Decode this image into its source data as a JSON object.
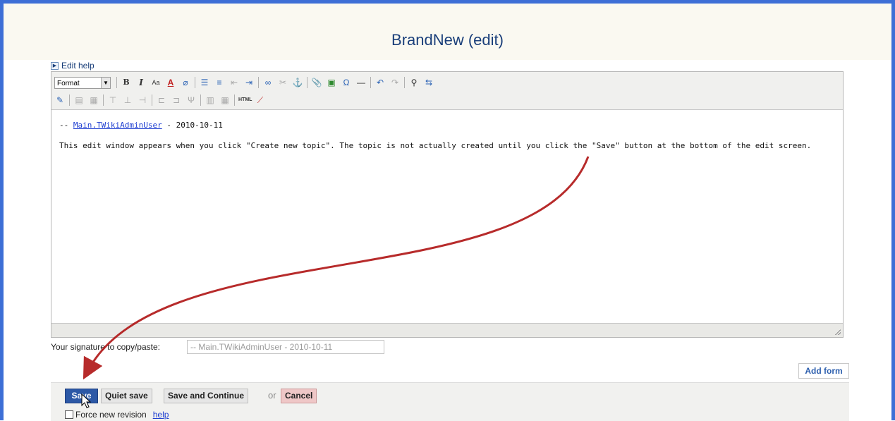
{
  "page": {
    "title": "BrandNew (edit)"
  },
  "edit_help": {
    "label": "Edit help"
  },
  "toolbar": {
    "format_label": "Format",
    "row1_icons": [
      "bold-icon",
      "italic-icon",
      "font-size-icon",
      "text-color-icon",
      "remove-format-icon",
      "bullet-list-icon",
      "numbered-list-icon",
      "outdent-icon",
      "indent-icon",
      "link-icon",
      "unlink-icon",
      "anchor-icon",
      "attachment-icon",
      "image-icon",
      "special-char-icon",
      "horizontal-rule-icon",
      "undo-icon",
      "redo-icon",
      "find-replace-icon",
      "replace-icon"
    ],
    "row2_icons": [
      "edit-source-icon",
      "table-icon",
      "table-props-icon",
      "insert-row-icon",
      "delete-row-icon",
      "insert-column-icon",
      "merge-cells-icon",
      "split-cells-icon",
      "table-cell-icon",
      "table-grid-icon",
      "html-icon",
      "tml-mode-icon"
    ],
    "html_label": "HTML"
  },
  "editor": {
    "signature_prefix": "-- ",
    "signature_link": "Main.TWikiAdminUser",
    "signature_suffix": " - 2010-10-11",
    "body_text": "This edit window appears when you click \"Create new topic\". The topic is not actually created until you click the \"Save\" button at the bottom of the edit screen."
  },
  "signature": {
    "label": "Your signature to copy/paste:",
    "value": "-- Main.TWikiAdminUser - 2010-10-11"
  },
  "buttons": {
    "add_form": "Add form",
    "save": "Save",
    "quiet_save": "Quiet save",
    "save_continue": "Save and Continue",
    "or": "or",
    "cancel": "Cancel"
  },
  "force_revision": {
    "label": "Force new revision",
    "help": "help",
    "checked": false
  },
  "colors": {
    "frame": "#3d6fd6",
    "save_button": "#2c58a6",
    "annotation_arrow": "#b01515",
    "link": "#1f3fd1"
  }
}
